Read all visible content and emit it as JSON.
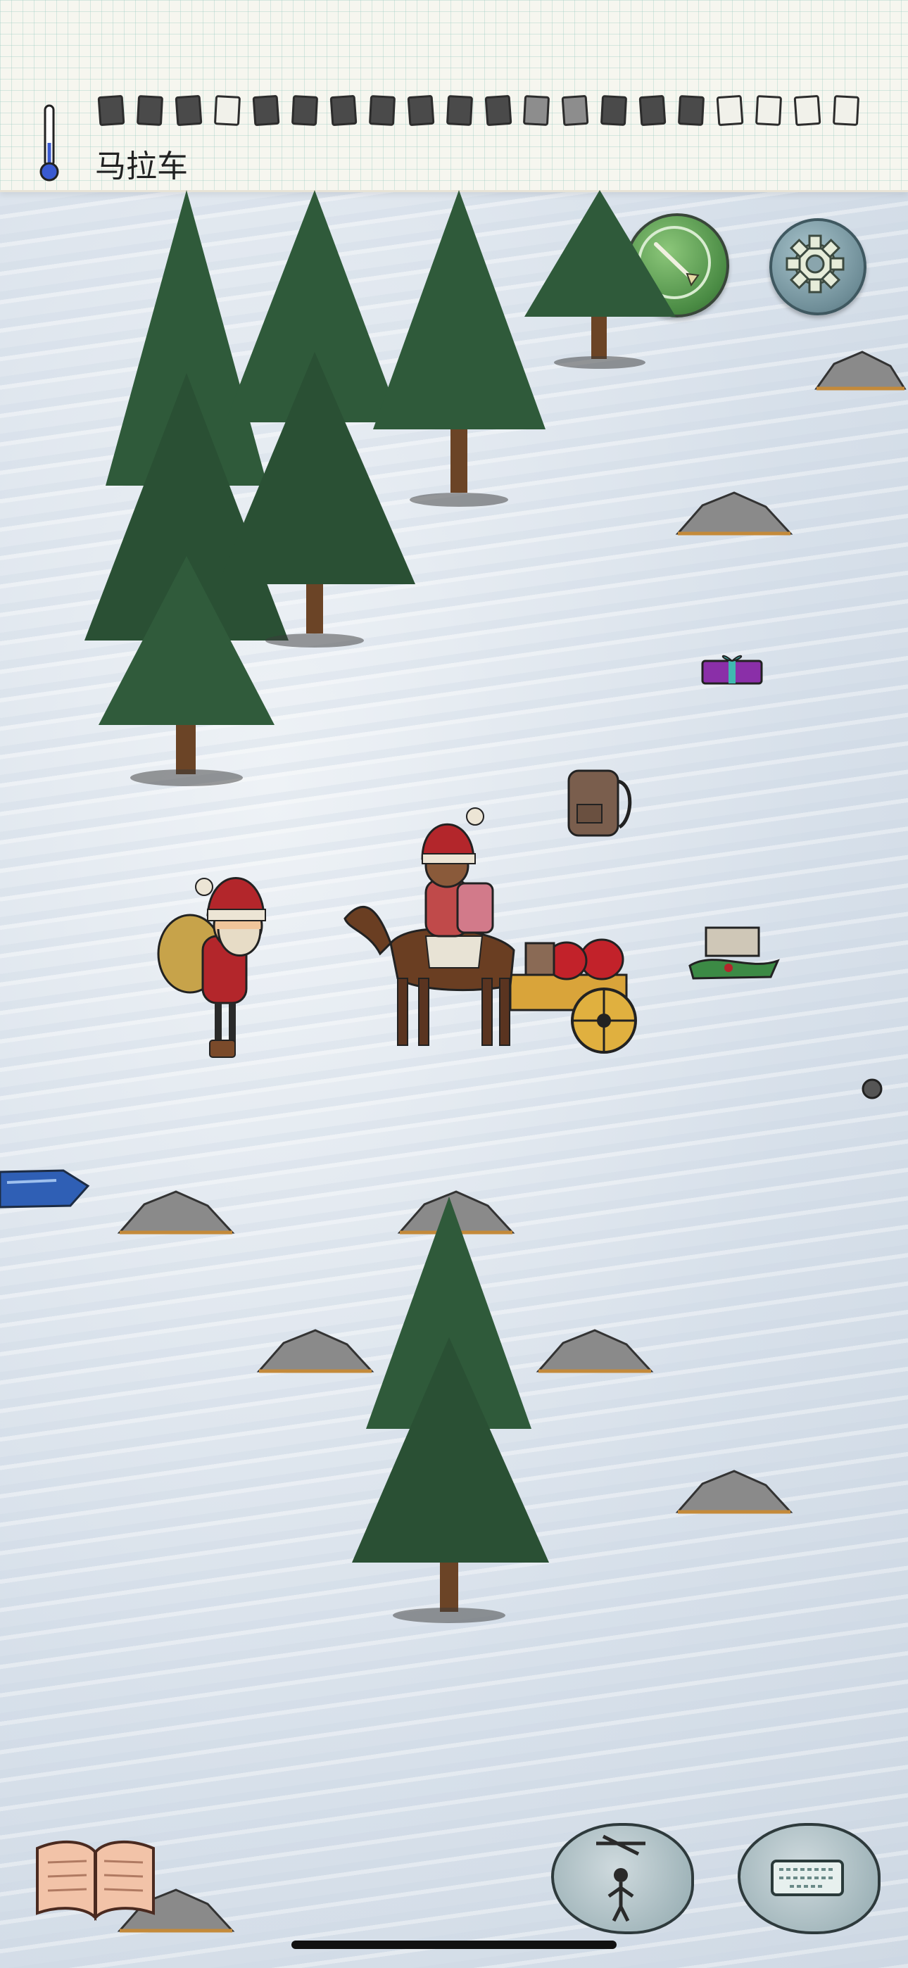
{
  "header": {
    "title": "马拉车",
    "palette": [
      "dark",
      "dark",
      "dark",
      "light",
      "dark",
      "dark",
      "dark",
      "dark",
      "dark",
      "dark",
      "dark",
      "mid",
      "mid",
      "dark",
      "dark",
      "dark",
      "light",
      "light",
      "light",
      "light"
    ]
  },
  "controls": {
    "compass_icon": "compass-icon",
    "settings_icon": "gear-icon",
    "book_icon": "open-book-icon",
    "puppet_icon": "puppet-icon",
    "keyboard_icon": "keyboard-icon"
  },
  "colors": {
    "snow": "#dfe7ee",
    "tree": "#2f5a3a",
    "trunk": "#6b4426",
    "rock": "#8a8a8a",
    "compass": "#4a8b44",
    "settings": "#6f8e98",
    "red": "#b3262b"
  }
}
